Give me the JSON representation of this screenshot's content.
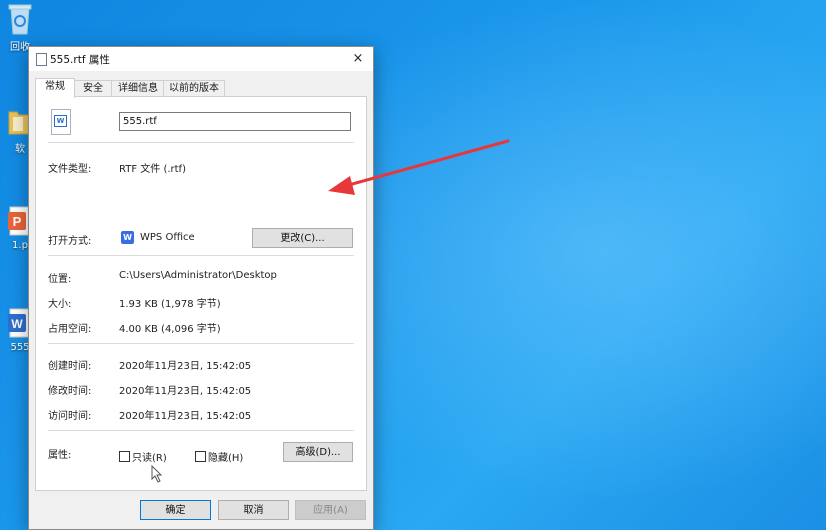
{
  "desktop": {
    "icons": [
      {
        "label": "回收",
        "name": "recycle-bin"
      },
      {
        "label": "软",
        "name": "folder"
      },
      {
        "label": "1.p",
        "name": "ppt-file"
      },
      {
        "label": "555",
        "name": "word-file"
      }
    ]
  },
  "dialog": {
    "title": "555.rtf 属性",
    "close": "×",
    "tabs": [
      "常规",
      "安全",
      "详细信息",
      "以前的版本"
    ],
    "filename": "555.rtf",
    "type_label": "文件类型:",
    "type_value": "RTF 文件 (.rtf)",
    "open_label": "打开方式:",
    "open_value": "WPS Office",
    "wps_glyph": "W",
    "change_button": "更改(C)...",
    "location_label": "位置:",
    "location_value": "C:\\Users\\Administrator\\Desktop",
    "size_label": "大小:",
    "size_value": "1.93 KB (1,978 字节)",
    "disk_label": "占用空间:",
    "disk_value": "4.00 KB (4,096 字节)",
    "created_label": "创建时间:",
    "created_value": "2020年11月23日, 15:42:05",
    "modified_label": "修改时间:",
    "modified_value": "2020年11月23日, 15:42:05",
    "accessed_label": "访问时间:",
    "accessed_value": "2020年11月23日, 15:42:05",
    "attr_label": "属性:",
    "readonly_label": "只读(R)",
    "hidden_label": "隐藏(H)",
    "advanced_button": "高级(D)...",
    "ok_button": "确定",
    "cancel_button": "取消",
    "apply_button": "应用(A)"
  },
  "colors": {
    "accent_arrow": "#e8373a",
    "desktop": "#1a96ea",
    "focus_border": "#0078d7"
  }
}
